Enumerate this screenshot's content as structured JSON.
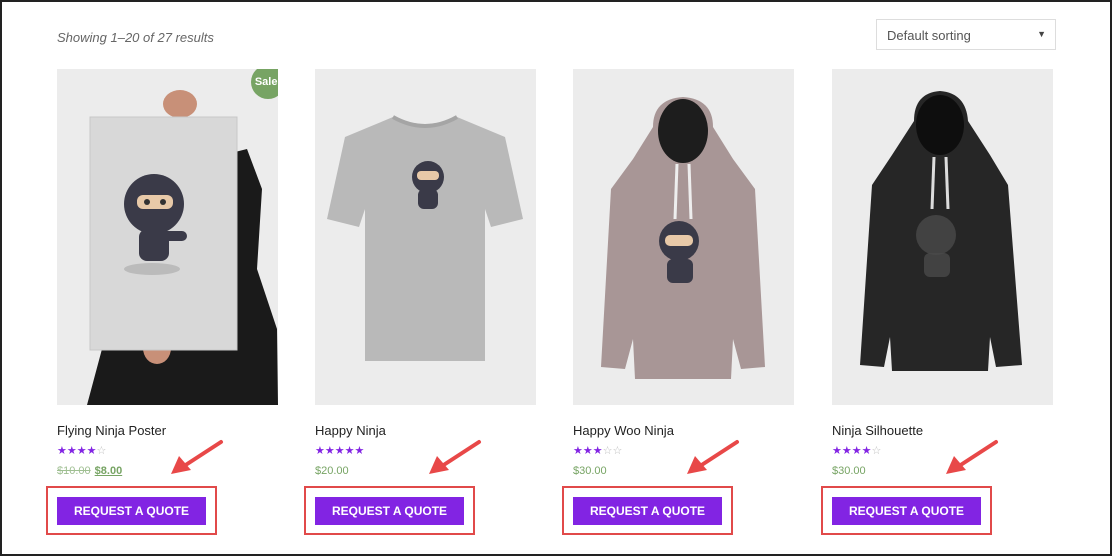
{
  "results": {
    "text": "Showing 1–20 of 27 results"
  },
  "sorting": {
    "selected": "Default sorting"
  },
  "products": [
    {
      "name": "Flying Ninja Poster",
      "rating": 4,
      "stars": "★★★★",
      "stars_empty": "☆",
      "price_old": "$10.00",
      "price": "$8.00",
      "badge": "Sale!",
      "button": "REQUEST A QUOTE",
      "image": "poster"
    },
    {
      "name": "Happy Ninja",
      "rating": 5,
      "stars": "★★★★★",
      "stars_empty": "",
      "price_old": "",
      "price": "$20.00",
      "badge": "",
      "button": "REQUEST A QUOTE",
      "image": "tshirt"
    },
    {
      "name": "Happy Woo Ninja",
      "rating": 3,
      "stars": "★★★",
      "stars_empty": "☆☆",
      "price_old": "",
      "price": "$30.00",
      "badge": "",
      "button": "REQUEST A QUOTE",
      "image": "hoodie-pink"
    },
    {
      "name": "Ninja Silhouette",
      "rating": 4,
      "stars": "★★★★",
      "stars_empty": "☆",
      "price_old": "",
      "price": "$30.00",
      "badge": "",
      "button": "REQUEST A QUOTE",
      "image": "hoodie-black"
    }
  ],
  "colors": {
    "button": "#8224e3",
    "price": "#77a464",
    "sale_badge": "#77a464",
    "highlight": "#e14a4a"
  }
}
